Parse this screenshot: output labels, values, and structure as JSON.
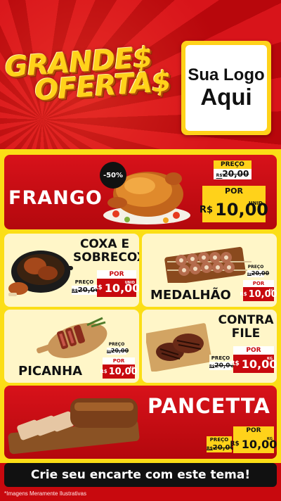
{
  "header": {
    "title_line1": "GRANDE$",
    "title_line2": "OFERTA$",
    "logo_line1": "Sua Logo",
    "logo_line2": "Aqui"
  },
  "products": {
    "frango": {
      "name": "FRANGO",
      "badge": "-50%",
      "preco_label": "PREÇO",
      "old_prefix": "R$",
      "old_price": "20,00",
      "por_label": "POR",
      "currency": "R$",
      "price": "10,00",
      "unit": "UNID"
    },
    "coxa": {
      "name_line1": "COXA E",
      "name_line2": "SOBRECOXA",
      "preco_label": "PREÇO",
      "old_prefix": "R$",
      "old_price": "20,00",
      "por_label": "POR",
      "currency": "R$",
      "price": "10,00",
      "unit": "UNID"
    },
    "medalhao": {
      "name": "MEDALHÃO",
      "preco_label": "PREÇO",
      "old_prefix": "R$",
      "old_price": "20,00",
      "por_label": "POR",
      "currency": "R$",
      "price": "10,00",
      "unit": "KG"
    },
    "picanha": {
      "name": "PICANHA",
      "preco_label": "PREÇO",
      "old_prefix": "R$",
      "old_price": "20,00",
      "por_label": "POR",
      "currency": "R$",
      "price": "10,00",
      "unit": "KG"
    },
    "contrafile": {
      "name_line1": "CONTRA",
      "name_line2": "FILE",
      "preco_label": "PREÇO",
      "old_prefix": "R$",
      "old_price": "20,00",
      "por_label": "POR",
      "currency": "R$",
      "price": "10,00",
      "unit": "KG"
    },
    "pancetta": {
      "name": "PANCETTA",
      "preco_label": "PREÇO",
      "old_prefix": "R$",
      "old_price": "20,00",
      "por_label": "POR",
      "currency": "R$",
      "price": "10,00",
      "unit": "KG"
    }
  },
  "footer": {
    "cta": "Crie seu encarte com este tema!",
    "disclaimer": "*Imagens Meramente Ilustrativas"
  },
  "colors": {
    "brand_red": "#c8090e",
    "brand_yellow": "#fbde16",
    "cream": "#fff6c8"
  }
}
